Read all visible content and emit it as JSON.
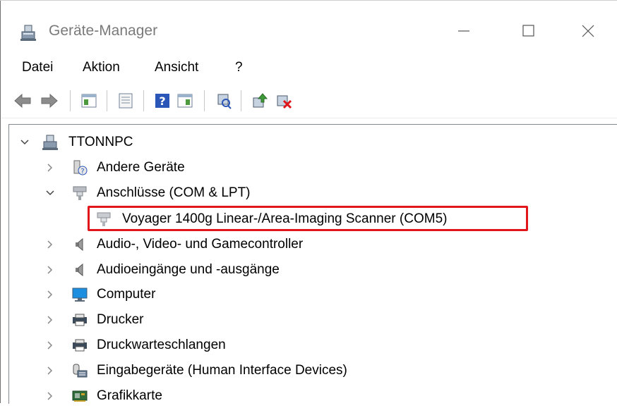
{
  "window": {
    "title": "Geräte-Manager",
    "controls": {
      "minimize_icon": "minimize-icon",
      "maximize_icon": "maximize-icon",
      "close_icon": "close-icon"
    }
  },
  "menu": {
    "items": [
      {
        "label": "Datei"
      },
      {
        "label": "Aktion"
      },
      {
        "label": "Ansicht"
      },
      {
        "label": "?"
      }
    ]
  },
  "toolbar": {
    "buttons": [
      "back-arrow-icon",
      "forward-arrow-icon",
      "show-hide-console-tree-icon",
      "properties-icon",
      "help-icon",
      "action-pane-icon",
      "scan-hardware-icon",
      "update-driver-icon",
      "uninstall-device-icon"
    ]
  },
  "tree": {
    "root": {
      "label": "TTONNPC",
      "expanded": true,
      "icon": "computer-tower-icon"
    },
    "nodes": [
      {
        "label": "Andere Geräte",
        "expanded": false,
        "icon": "unknown-device-icon"
      },
      {
        "label": "Anschlüsse (COM & LPT)",
        "expanded": true,
        "icon": "port-connector-icon",
        "children": [
          {
            "label": "Voyager 1400g Linear-/Area-Imaging Scanner (COM5)",
            "icon": "port-connector-icon",
            "highlighted": true
          }
        ]
      },
      {
        "label": "Audio-, Video- und Gamecontroller",
        "expanded": false,
        "icon": "speaker-icon"
      },
      {
        "label": "Audioeingänge und -ausgänge",
        "expanded": false,
        "icon": "speaker-icon"
      },
      {
        "label": "Computer",
        "expanded": false,
        "icon": "monitor-icon"
      },
      {
        "label": "Drucker",
        "expanded": false,
        "icon": "printer-icon"
      },
      {
        "label": "Druckwarteschlangen",
        "expanded": false,
        "icon": "printer-icon"
      },
      {
        "label": "Eingabegeräte (Human Interface Devices)",
        "expanded": false,
        "icon": "hid-device-icon"
      },
      {
        "label": "Grafikkarte",
        "expanded": false,
        "icon": "graphics-card-icon"
      }
    ]
  },
  "colors": {
    "highlight_border": "#e0161b",
    "title_text": "#7a7a7a"
  }
}
